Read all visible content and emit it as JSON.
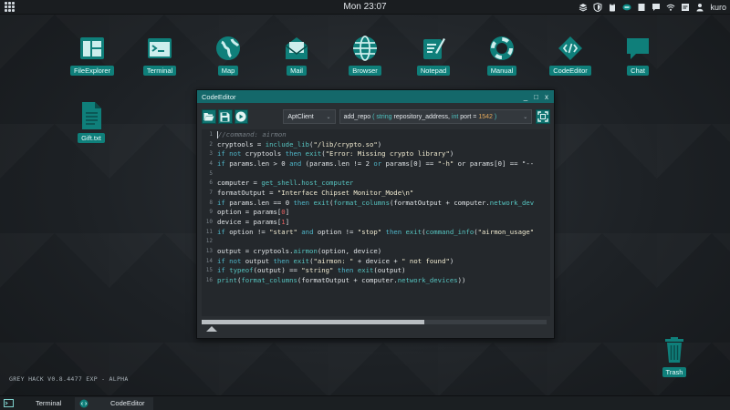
{
  "topbar": {
    "clock": "Mon 23:07",
    "user": "kuro"
  },
  "desktop": {
    "icons": [
      {
        "label": "FileExplorer",
        "icon": "file-explorer-icon"
      },
      {
        "label": "Terminal",
        "icon": "terminal-icon"
      },
      {
        "label": "Map",
        "icon": "globe-icon"
      },
      {
        "label": "Mail",
        "icon": "mail-icon"
      },
      {
        "label": "Browser",
        "icon": "browser-icon"
      },
      {
        "label": "Notepad",
        "icon": "notepad-icon"
      },
      {
        "label": "Manual",
        "icon": "lifebuoy-icon"
      },
      {
        "label": "CodeEditor",
        "icon": "code-editor-icon"
      },
      {
        "label": "Chat",
        "icon": "chat-icon"
      }
    ],
    "file": {
      "label": "Gift.txt"
    },
    "trash": {
      "label": "Trash"
    }
  },
  "editor": {
    "title": "CodeEditor",
    "controls": {
      "minimize": "_",
      "maximize": "□",
      "close": "x"
    },
    "class_select": "AptClient",
    "method_select": {
      "name": "add_repo",
      "open": "(",
      "type1": "string",
      "param1": "repository_address,",
      "type2": "int",
      "param2": "port",
      "eq": "=",
      "default": "1542",
      "close": ")"
    },
    "lines": [
      {
        "n": "1",
        "comment": "//command: airmon"
      },
      {
        "n": "2",
        "a": "cryptools = ",
        "f": "include_lib",
        "b": "(",
        "s": "\"/lib/crypto.so\"",
        "c": ")"
      },
      {
        "n": "3",
        "k1": "if not",
        "a": " cryptools ",
        "k2": "then",
        "b": " ",
        "f": "exit",
        "c": "(",
        "s": "\"Error: Missing crypto library\"",
        "d": ")"
      },
      {
        "n": "4",
        "k1": "if",
        "a": " params.len > 0 ",
        "k2": "and",
        "b": " (params.len != 2 ",
        "k3": "or",
        "c": " params[0] == ",
        "s": "\"-h\"",
        "d": " or params[0] == \"--",
        "e": ""
      },
      {
        "n": "5"
      },
      {
        "n": "6",
        "a": "computer = ",
        "f": "get_shell",
        "b": ".",
        "f2": "host_computer"
      },
      {
        "n": "7",
        "a": "formatOutput = ",
        "s": "\"Interface Chipset Monitor_Mode\\n\""
      },
      {
        "n": "8",
        "k1": "if",
        "a": " params.len == 0 ",
        "k2": "then",
        "b": " ",
        "f": "exit",
        "c": "(",
        "f2": "format_columns",
        "d": "(formatOutput + computer.",
        "f3": "network_dev"
      },
      {
        "n": "9",
        "a": "option = params[",
        "r": "0",
        "b": "]"
      },
      {
        "n": "10",
        "a": "device = params[",
        "r": "1",
        "b": "]"
      },
      {
        "n": "11",
        "k1": "if",
        "a": " option != ",
        "s": "\"start\"",
        "k2": " and",
        "b": " option != ",
        "s2": "\"stop\"",
        "k3": " then",
        "c": " ",
        "f": "exit",
        "d": "(",
        "f2": "command_info",
        "e": "(",
        "s3": "\"airmon_usage\""
      },
      {
        "n": "12"
      },
      {
        "n": "13",
        "a": "output = cryptools.",
        "f": "airmon",
        "b": "(option, device)"
      },
      {
        "n": "14",
        "k1": "if not",
        "a": " output ",
        "k2": "then",
        "b": " ",
        "f": "exit",
        "c": "(",
        "s": "\"airmon: \"",
        "d": " + device + ",
        "s2": "\" not found\"",
        "e": ")"
      },
      {
        "n": "15",
        "k1": "if",
        "a": " ",
        "f": "typeof",
        "b": "(output) == ",
        "s": "\"string\"",
        "k2": " then",
        "c": " ",
        "f2": "exit",
        "d": "(output)"
      },
      {
        "n": "16",
        "f": "print",
        "a": "(",
        "f2": "format_columns",
        "b": "(formatOutput + computer.",
        "f3": "network_devices",
        "c": "))"
      }
    ]
  },
  "version": "GREY HACK V0.8.4477 EXP - ALPHA",
  "taskbar": {
    "items": [
      {
        "label": "Terminal"
      },
      {
        "label": "CodeEditor"
      }
    ]
  },
  "colors": {
    "accent": "#0f7f7a",
    "titlebar": "#14686a",
    "keyword": "#4fb6c9",
    "number": "#e56060"
  }
}
